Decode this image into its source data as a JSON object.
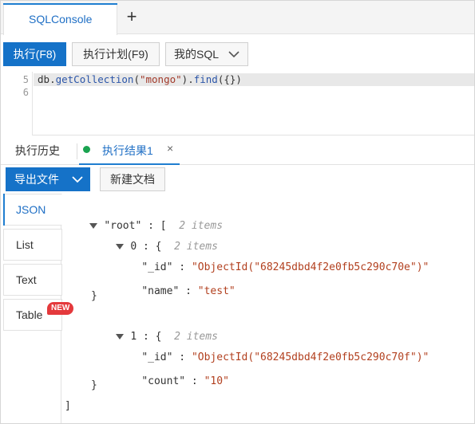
{
  "tabs": {
    "active_label": "SQLConsole",
    "add_symbol": "+"
  },
  "toolbar": {
    "run_label": "执行(F8)",
    "plan_label": "执行计划(F9)",
    "mysql_label": "我的SQL"
  },
  "editor": {
    "lines": [
      {
        "number": "5",
        "code": {
          "obj": "db",
          "dot1": ".",
          "fn1": "getCollection",
          "open1": "(",
          "arg": "\"mongo\"",
          "close1": ")",
          "dot2": ".",
          "fn2": "find",
          "open2": "(",
          "braces": "{}",
          "close2": ")"
        }
      },
      {
        "number": "6"
      }
    ]
  },
  "result_tabs": {
    "history_label": "执行历史",
    "result_label": "执行结果1",
    "close_symbol": "×"
  },
  "result_toolbar": {
    "export_label": "导出文件",
    "new_doc_label": "新建文档"
  },
  "views": [
    {
      "label": "JSON",
      "active": true
    },
    {
      "label": "List"
    },
    {
      "label": "Text"
    },
    {
      "label": "Table",
      "badge": "NEW"
    }
  ],
  "tree": {
    "root_key": "\"root\"",
    "root_sep": " : ",
    "root_open": "[",
    "root_comment": "2 items",
    "root_close": "]",
    "items": [
      {
        "index": "0",
        "sep": " : ",
        "open": "{",
        "comment": "2 items",
        "close": "}",
        "fields": [
          {
            "key": "\"_id\"",
            "sep": " : ",
            "value": "\"ObjectId(\"68245dbd4f2e0fb5c290c70e\")\""
          },
          {
            "key": "\"name\"",
            "sep": " : ",
            "value": "\"test\""
          }
        ]
      },
      {
        "index": "1",
        "sep": " : ",
        "open": "{",
        "comment": "2 items",
        "close": "}",
        "fields": [
          {
            "key": "\"_id\"",
            "sep": " : ",
            "value": "\"ObjectId(\"68245dbd4f2e0fb5c290c70f\")\""
          },
          {
            "key": "\"count\"",
            "sep": " : ",
            "value": "\"10\""
          }
        ]
      }
    ]
  },
  "colors": {
    "accent": "#1f7ed0",
    "primary_button": "#1572c8",
    "status_dot": "#1aa350",
    "badge": "#e4393c",
    "string": "#b2401f"
  },
  "icons": {
    "add_tab": "plus-icon",
    "dropdown": "chevron-down-icon",
    "close": "close-icon",
    "status": "status-dot-icon",
    "expand": "caret-down-icon"
  }
}
